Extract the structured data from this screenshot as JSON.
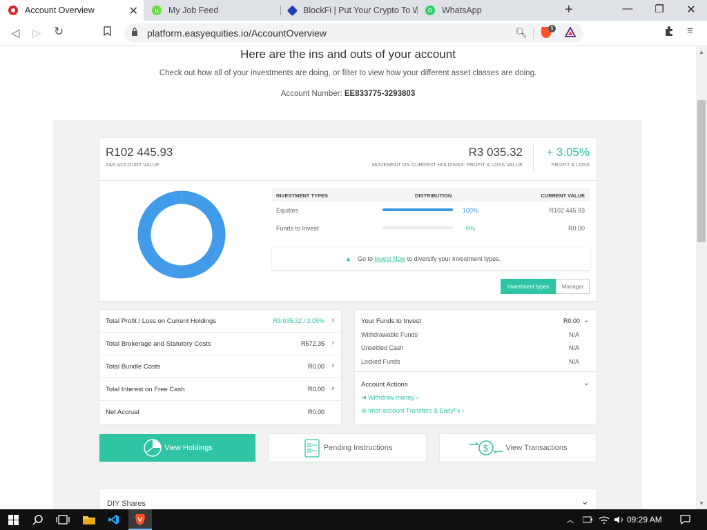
{
  "browser": {
    "tabs": [
      {
        "title": "Account Overview",
        "active": true
      },
      {
        "title": "My Job Feed",
        "active": false
      },
      {
        "title": "BlockFi | Put Your Crypto To Wo",
        "active": false
      },
      {
        "title": "WhatsApp",
        "active": false
      }
    ],
    "url": "platform.easyequities.io/AccountOverview",
    "brave_badge": "5"
  },
  "page": {
    "title": "Here are the ins and outs of your account",
    "subtitle": "Check out how all of your investments are doing, or filter to view how your different asset classes are doing.",
    "account_label": "Account Number:",
    "account_number": "EE833775-3293803"
  },
  "summary": {
    "account_value": "R102 445.93",
    "account_value_caption": "ZAR ACCOUNT VALUE",
    "movement_value": "R3 035.32",
    "movement_caption": "MOVEMENT ON CURRENT HOLDINGS:  PROFIT & LOSS VALUE",
    "pl_percent": "+ 3.05%",
    "pl_caption": "PROFIT & LOSS"
  },
  "investment_types": {
    "headers": [
      "INVESTMENT TYPES",
      "DISTRIBUTION",
      "CURRENT VALUE"
    ],
    "rows": [
      {
        "type": "Equities",
        "percent": "100%",
        "value": "R102 445.93",
        "fraction": 1.0
      },
      {
        "type": "Funds to Invest",
        "percent": "0%",
        "value": "R0.00",
        "fraction": 0.0
      }
    ],
    "goto_prefix": "Go to",
    "goto_link": "Invest Now",
    "goto_suffix": "to diversify your investment types.",
    "toggle_active": "Investment types",
    "toggle_inactive": "Manager"
  },
  "donut": {
    "equities_fraction": 1.0,
    "color": "#419be8",
    "cap_color": "#2ec4a4"
  },
  "left_list": [
    {
      "label": "Total Profit / Loss on Current Holdings",
      "value": "R3 035.32 / 3.05%",
      "green": true,
      "chevron": true
    },
    {
      "label": "Total Brokerage and Statutory Costs",
      "value": "R572.35",
      "green": false,
      "chevron": true
    },
    {
      "label": "Total Bundle Costs",
      "value": "R0.00",
      "green": false,
      "chevron": true
    },
    {
      "label": "Total Interest on Free Cash",
      "value": "R0.00",
      "green": false,
      "chevron": true
    },
    {
      "label": "Net Accrual",
      "value": "R0.00",
      "green": false,
      "chevron": false
    }
  ],
  "funds": {
    "title": "Your Funds to Invest",
    "value": "R0.00",
    "rows": [
      {
        "label": "Withdrawable Funds",
        "value": "N/A"
      },
      {
        "label": "Unsettled Cash",
        "value": "N/A"
      },
      {
        "label": "Locked Funds",
        "value": "N/A"
      }
    ],
    "actions_title": "Account Actions",
    "actions": [
      "Withdraw money",
      "Inter-account Transfers & EasyFx"
    ]
  },
  "buttons": {
    "holdings": "View Holdings",
    "pending": "Pending Instructions",
    "transactions": "View Transactions"
  },
  "diy": {
    "label": "DIY Shares"
  },
  "taskbar": {
    "time": "09:29 AM"
  },
  "colors": {
    "accent": "#2ec4a4",
    "blue": "#419be8"
  }
}
